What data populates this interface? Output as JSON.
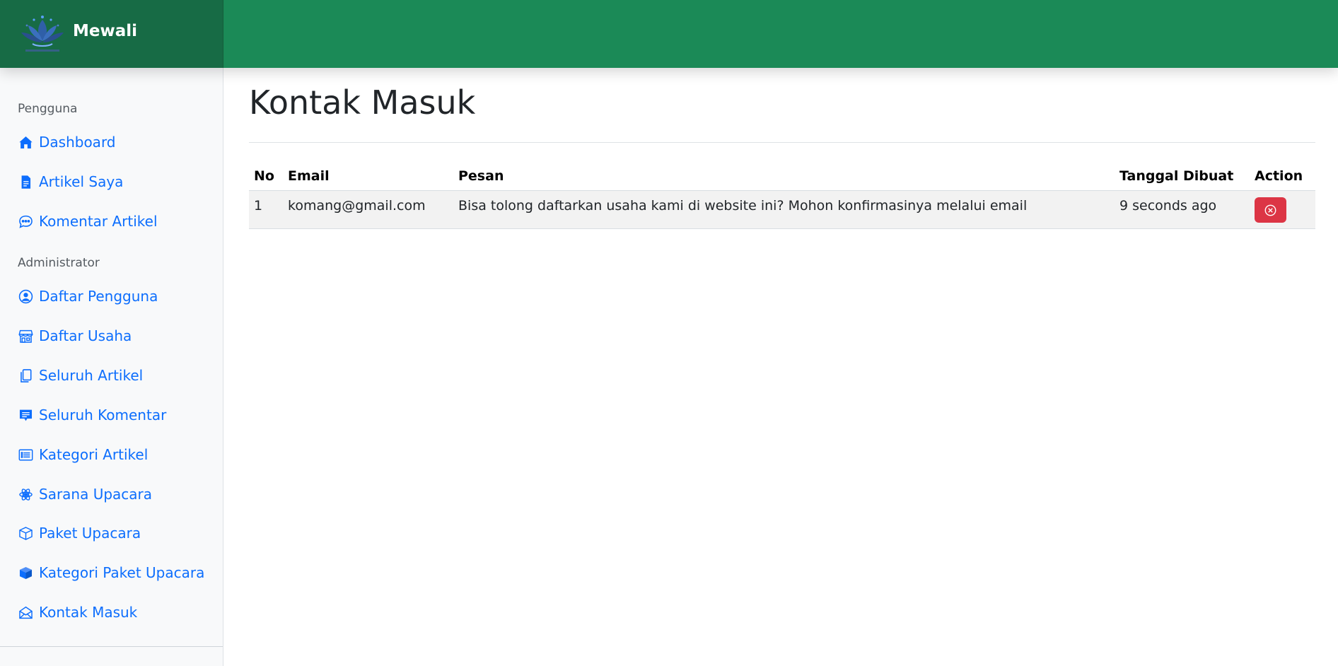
{
  "brand": {
    "name": "Mewali",
    "logo_icon": "lotus-logo-icon"
  },
  "colors": {
    "topbar": "#1b8a57",
    "brand_bg": "#176b45",
    "link": "#0d6efd",
    "danger": "#dc3545",
    "sidebar_bg": "#f8f9fa"
  },
  "sidebar": {
    "sections": [
      {
        "heading": "Pengguna",
        "items": [
          {
            "label": "Dashboard",
            "icon": "house-icon"
          },
          {
            "label": "Artikel Saya",
            "icon": "file-text-icon"
          },
          {
            "label": "Komentar Artikel",
            "icon": "chat-dots-icon"
          }
        ]
      },
      {
        "heading": "Administrator",
        "items": [
          {
            "label": "Daftar Pengguna",
            "icon": "person-circle-icon"
          },
          {
            "label": "Daftar Usaha",
            "icon": "shop-icon"
          },
          {
            "label": "Seluruh Artikel",
            "icon": "files-icon"
          },
          {
            "label": "Seluruh Komentar",
            "icon": "chat-square-text-icon"
          },
          {
            "label": "Kategori Artikel",
            "icon": "list-card-icon"
          },
          {
            "label": "Sarana Upacara",
            "icon": "flower-icon"
          },
          {
            "label": "Paket Upacara",
            "icon": "box-icon"
          },
          {
            "label": "Kategori Paket Upacara",
            "icon": "box-filled-icon"
          },
          {
            "label": "Kontak Masuk",
            "icon": "envelope-open-icon"
          }
        ]
      }
    ]
  },
  "main": {
    "title": "Kontak Masuk",
    "table": {
      "columns": [
        "No",
        "Email",
        "Pesan",
        "Tanggal Dibuat",
        "Action"
      ],
      "rows": [
        {
          "no": "1",
          "email": "komang@gmail.com",
          "pesan": "Bisa tolong daftarkan usaha kami di website ini? Mohon konfirmasinya melalui email",
          "tanggal": "9 seconds ago",
          "action_icon": "x-circle-icon"
        }
      ]
    }
  }
}
